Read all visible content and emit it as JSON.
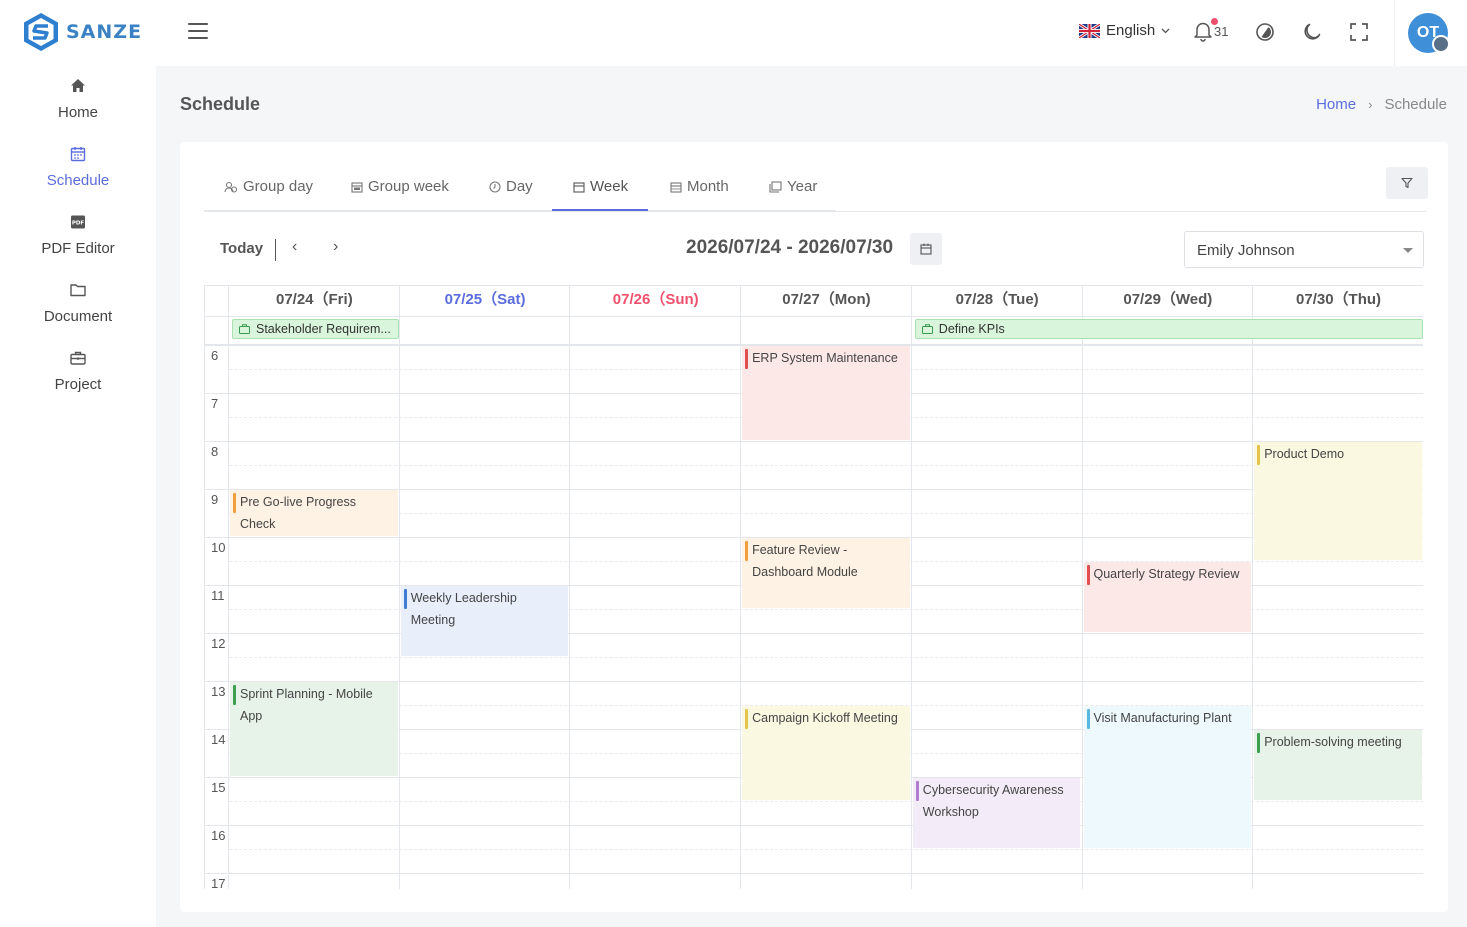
{
  "brand": {
    "name": "SANZE"
  },
  "sidebar": {
    "items": [
      {
        "label": "Home",
        "icon": "home-icon"
      },
      {
        "label": "Schedule",
        "icon": "calendar-icon",
        "active": true
      },
      {
        "label": "PDF Editor",
        "icon": "pdf-icon"
      },
      {
        "label": "Document",
        "icon": "folder-icon"
      },
      {
        "label": "Project",
        "icon": "briefcase-icon"
      }
    ]
  },
  "header": {
    "language": "English",
    "notification_count": "31",
    "avatar_initials": "OT"
  },
  "page": {
    "title": "Schedule"
  },
  "breadcrumb": {
    "home": "Home",
    "current": "Schedule"
  },
  "tabs": [
    {
      "label": "Group day",
      "icon": "group-icon"
    },
    {
      "label": "Group week",
      "icon": "calendar-icon"
    },
    {
      "label": "Day",
      "icon": "clock-icon"
    },
    {
      "label": "Week",
      "icon": "calendar-icon",
      "active": true
    },
    {
      "label": "Month",
      "icon": "calendar-icon"
    },
    {
      "label": "Year",
      "icon": "calendar-icon"
    }
  ],
  "toolbar": {
    "today": "Today",
    "prev": "‹",
    "next": "›",
    "range": "2026/07/24 - 2026/07/30",
    "user_select": "Emily Johnson"
  },
  "days": [
    {
      "label": "07/24（Fri)",
      "color": "#555555"
    },
    {
      "label": "07/25（Sat)",
      "color": "#5b6ddc"
    },
    {
      "label": "07/26（Sun)",
      "color": "#f0506e"
    },
    {
      "label": "07/27（Mon)",
      "color": "#555555"
    },
    {
      "label": "07/28（Tue)",
      "color": "#555555"
    },
    {
      "label": "07/29（Wed)",
      "color": "#555555"
    },
    {
      "label": "07/30（Thu)",
      "color": "#555555"
    }
  ],
  "hours": [
    "6",
    "7",
    "8",
    "9",
    "10",
    "11",
    "12",
    "13",
    "14",
    "15",
    "16",
    "17"
  ],
  "allday_events": [
    {
      "title": "Stakeholder Requirem...",
      "day": 0,
      "span": 1
    },
    {
      "title": "Define KPIs",
      "day": 4,
      "span": 3
    }
  ],
  "events": [
    {
      "title": "ERP System Maintenance",
      "day": 3,
      "start": 6,
      "end": 8,
      "bg": "#fde8e8",
      "bar": "#e05050"
    },
    {
      "title": "Product Demo",
      "day": 6,
      "start": 8,
      "end": 10.5,
      "bg": "#fbf8e1",
      "bar": "#e6c34a"
    },
    {
      "title": "Pre Go-live Progress Check",
      "day": 0,
      "start": 9,
      "end": 10,
      "bg": "#fdf2e3",
      "bar": "#f0a040"
    },
    {
      "title": "Feature Review - Dashboard Module",
      "day": 3,
      "start": 10,
      "end": 11.5,
      "bg": "#fdf2e3",
      "bar": "#f0a040"
    },
    {
      "title": "Quarterly Strategy Review",
      "day": 5,
      "start": 10.5,
      "end": 12,
      "bg": "#fde8e8",
      "bar": "#e05050"
    },
    {
      "title": "Weekly Leadership Meeting",
      "day": 1,
      "start": 11,
      "end": 12.5,
      "bg": "#e8eefa",
      "bar": "#3f7dd0"
    },
    {
      "title": "Sprint Planning - Mobile App",
      "day": 0,
      "start": 13,
      "end": 15,
      "bg": "#e7f3e8",
      "bar": "#3aa050"
    },
    {
      "title": "Campaign Kickoff Meeting",
      "day": 3,
      "start": 13.5,
      "end": 15.5,
      "bg": "#fbf8e1",
      "bar": "#e6c34a"
    },
    {
      "title": "Visit Manufacturing Plant",
      "day": 5,
      "start": 13.5,
      "end": 16.5,
      "bg": "#eef9fd",
      "bar": "#5ab8e0"
    },
    {
      "title": "Problem-solving meeting",
      "day": 6,
      "start": 14,
      "end": 15.5,
      "bg": "#e7f3e8",
      "bar": "#3aa050"
    },
    {
      "title": "Cybersecurity Awareness Workshop",
      "day": 4,
      "start": 15,
      "end": 16.5,
      "bg": "#f3ecf8",
      "bar": "#b07cd0"
    }
  ]
}
